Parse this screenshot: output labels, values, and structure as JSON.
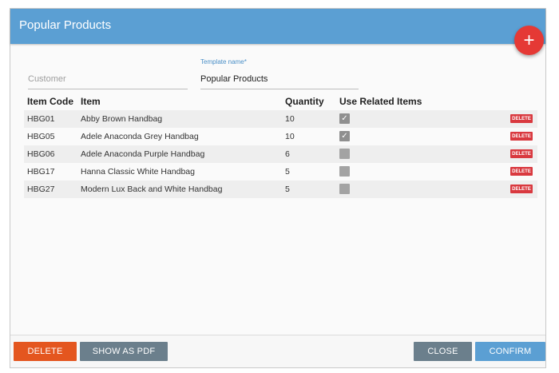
{
  "dialog": {
    "title": "Popular Products",
    "add_button": "+"
  },
  "form": {
    "customer": {
      "placeholder": "Customer",
      "value": ""
    },
    "template": {
      "label": "Template name*",
      "value": "Popular Products"
    }
  },
  "table": {
    "headers": {
      "code": "Item Code",
      "item": "Item",
      "quantity": "Quantity",
      "related": "Use Related Items"
    },
    "delete_label": "DELETE",
    "rows": [
      {
        "code": "HBG01",
        "item": "Abby Brown Handbag",
        "quantity": "10",
        "related": true
      },
      {
        "code": "HBG05",
        "item": "Adele Anaconda Grey Handbag",
        "quantity": "10",
        "related": true
      },
      {
        "code": "HBG06",
        "item": "Adele Anaconda Purple Handbag",
        "quantity": "6",
        "related": false
      },
      {
        "code": "HBG17",
        "item": "Hanna Classic White Handbag",
        "quantity": "5",
        "related": false
      },
      {
        "code": "HBG27",
        "item": "Modern Lux Back and White Handbag",
        "quantity": "5",
        "related": false
      }
    ]
  },
  "footer": {
    "delete_label": "DELETE",
    "pdf_label": "SHOW AS PDF",
    "close_label": "CLOSE",
    "confirm_label": "CONFIRM"
  },
  "colors": {
    "header": "#5b9fd3",
    "fab": "#e53935",
    "delete": "#e4561f",
    "neutral_button": "#6b7f8c",
    "row_delete": "#d9393f"
  }
}
